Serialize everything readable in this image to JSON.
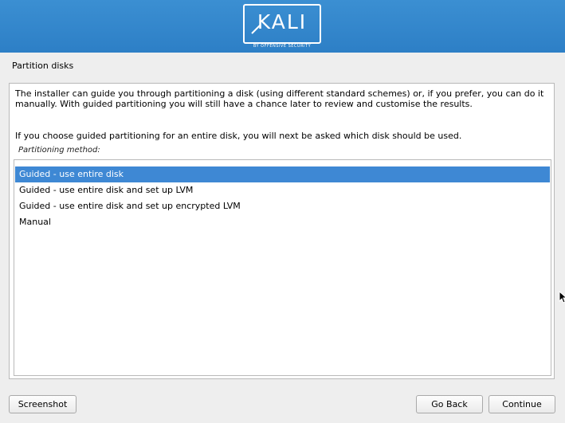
{
  "header": {
    "logo_text": "KALI",
    "logo_tagline": "BY OFFENSIVE SECURITY"
  },
  "page": {
    "title": "Partition disks"
  },
  "content": {
    "description": "The installer can guide you through partitioning a disk (using different standard schemes) or, if you prefer, you can do it manually. With guided partitioning you will still have a chance later to review and customise the results.",
    "description2": "If you choose guided partitioning for an entire disk, you will next be asked which disk should be used.",
    "method_label": "Partitioning method:"
  },
  "methods": [
    {
      "label": "Guided - use entire disk",
      "selected": true
    },
    {
      "label": "Guided - use entire disk and set up LVM",
      "selected": false
    },
    {
      "label": "Guided - use entire disk and set up encrypted LVM",
      "selected": false
    },
    {
      "label": "Manual",
      "selected": false
    }
  ],
  "buttons": {
    "screenshot": "Screenshot",
    "go_back": "Go Back",
    "continue": "Continue"
  },
  "colors": {
    "banner": "#2d7fc6",
    "selection": "#3e88d4",
    "background": "#eeeeee"
  }
}
